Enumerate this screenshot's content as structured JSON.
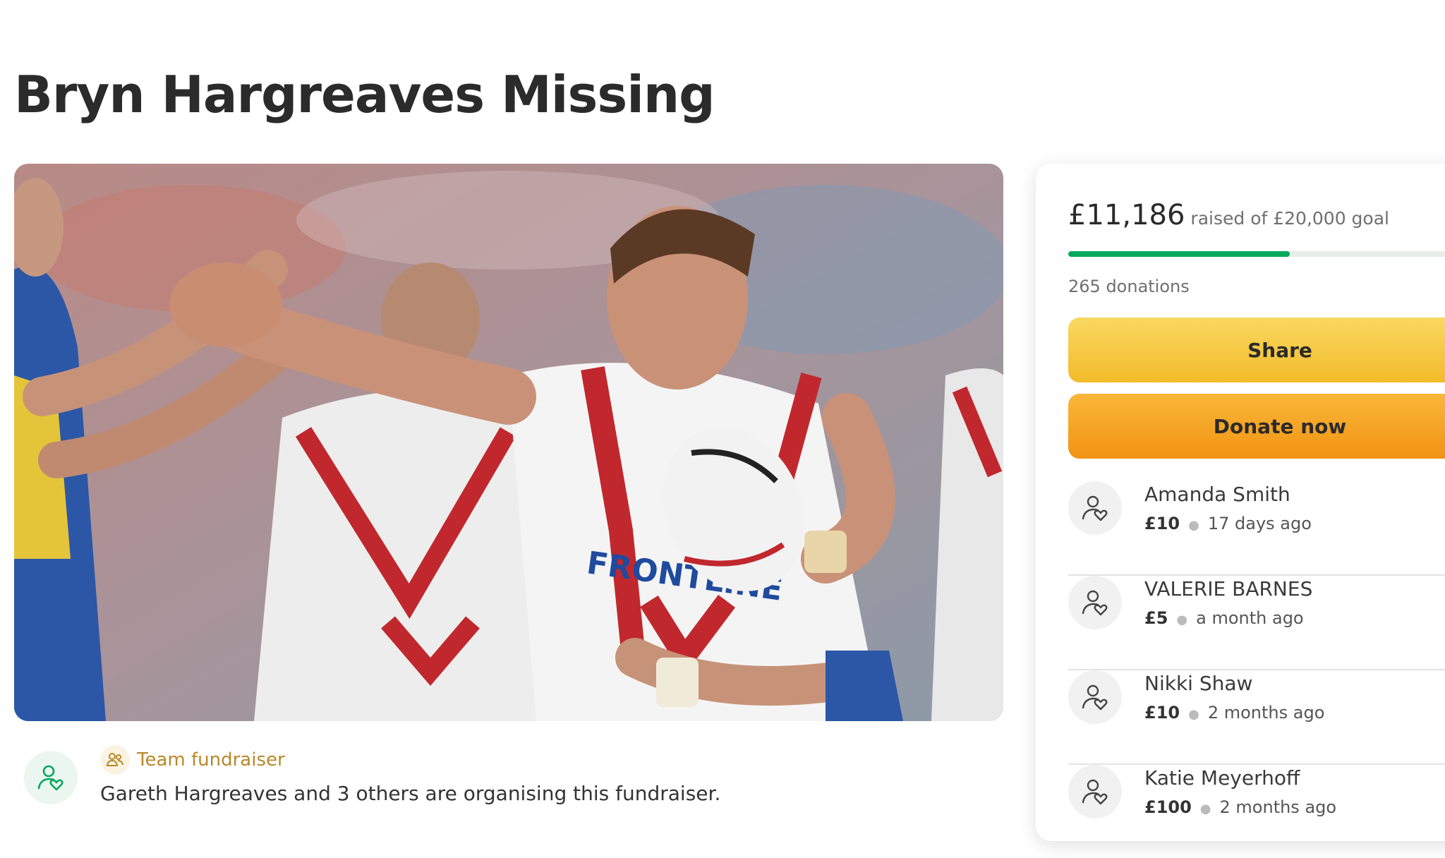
{
  "page": {
    "title": "Bryn Hargreaves Missing"
  },
  "organiser": {
    "team_badge": "Team fundraiser",
    "text": "Gareth Hargreaves and 3 others are organising this fundraiser."
  },
  "campaign": {
    "raised": "£11,186",
    "goal_text": "raised of £20,000 goal",
    "progress_fraction": 0.56,
    "donations": "265 donations",
    "share_label": "Share",
    "donate_label": "Donate now"
  },
  "donors": [
    {
      "name": "Amanda Smith",
      "amount": "£10",
      "time": "17 days ago"
    },
    {
      "name": "VALERIE BARNES",
      "amount": "£5",
      "time": "a month ago"
    },
    {
      "name": "Nikki Shaw",
      "amount": "£10",
      "time": "2 months ago"
    },
    {
      "name": "Katie Meyerhoff",
      "amount": "£100",
      "time": "2 months ago"
    }
  ],
  "colors": {
    "accent_green": "#02a95c",
    "share_yellow": "#f4c232",
    "donate_orange": "#f5a623",
    "team_gold": "#b9882b"
  },
  "icons": {
    "donor": "person-heart-icon",
    "team": "people-icon"
  }
}
